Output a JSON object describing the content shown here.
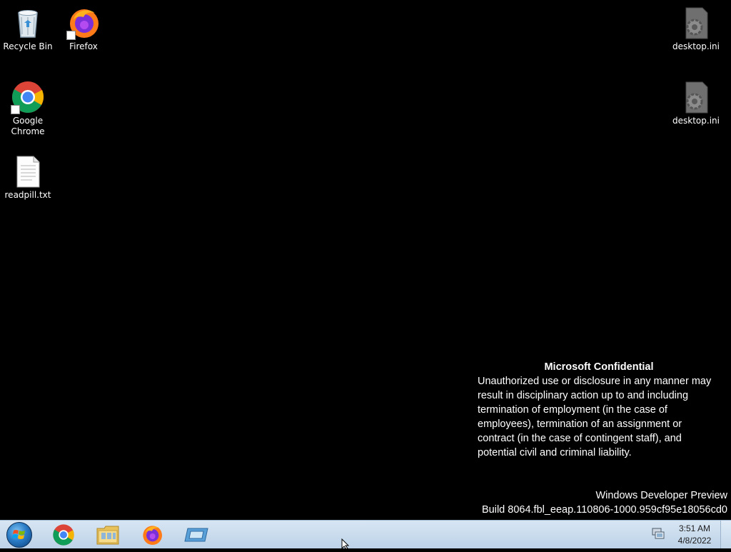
{
  "desktop": {
    "icons": [
      {
        "label": "Recycle Bin",
        "icon": "recycle-bin-icon"
      },
      {
        "label": "Firefox",
        "icon": "firefox-icon"
      },
      {
        "label": "Google Chrome",
        "icon": "chrome-icon"
      },
      {
        "label": "readpill.txt",
        "icon": "text-file-icon"
      },
      {
        "label": "desktop.ini",
        "icon": "settings-file-icon"
      },
      {
        "label": "desktop.ini",
        "icon": "settings-file-icon"
      }
    ]
  },
  "watermark": {
    "title": "Microsoft Confidential",
    "lines": [
      "Unauthorized use or disclosure in any manner may",
      "result in disciplinary action up to and including",
      "termination of employment (in the case of",
      "employees), termination of an assignment or",
      "contract (in the case of contingent staff), and",
      "potential civil and criminal liability."
    ]
  },
  "build": {
    "line1": "Windows Developer Preview",
    "line2": "Build 8064.fbl_eeap.110806-1000.959cf95e18056cd0"
  },
  "taskbar": {
    "pinned": [
      "chrome-icon",
      "file-explorer-icon",
      "firefox-icon",
      "window-switcher-icon"
    ],
    "clock": {
      "time": "3:51 AM",
      "date": "4/8/2022"
    }
  },
  "colors": {
    "desktop_bg": "#000000",
    "taskbar_bg": "#c9dcee"
  }
}
